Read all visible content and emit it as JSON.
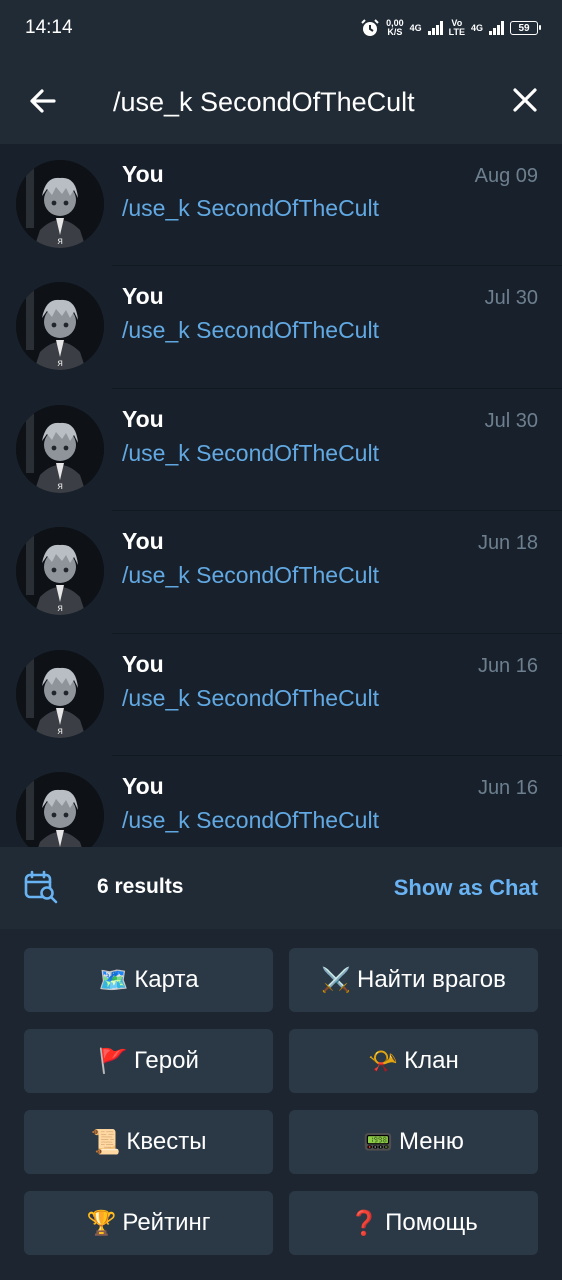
{
  "status": {
    "time": "14:14",
    "netspeed_value": "0,00",
    "netspeed_unit": "K/S",
    "net1": "4G",
    "volte_top": "Vo",
    "volte_bottom": "LTE",
    "net2": "4G",
    "battery": "59"
  },
  "search": {
    "query": "/use_k SecondOfTheCult"
  },
  "results": [
    {
      "title": "You",
      "text": "/use_k SecondOfTheCult",
      "date": "Aug 09",
      "avatar_letter": "я"
    },
    {
      "title": "You",
      "text": "/use_k SecondOfTheCult",
      "date": "Jul 30",
      "avatar_letter": "я"
    },
    {
      "title": "You",
      "text": "/use_k SecondOfTheCult",
      "date": "Jul 30",
      "avatar_letter": "я"
    },
    {
      "title": "You",
      "text": "/use_k SecondOfTheCult",
      "date": "Jun 18",
      "avatar_letter": "я"
    },
    {
      "title": "You",
      "text": "/use_k SecondOfTheCult",
      "date": "Jun 16",
      "avatar_letter": "я"
    },
    {
      "title": "You",
      "text": "/use_k SecondOfTheCult",
      "date": "Jun 16",
      "avatar_letter": "я"
    }
  ],
  "results_bar": {
    "count_label": "6 results",
    "show_as_chat": "Show as Chat"
  },
  "keyboard": [
    {
      "emoji": "🗺️",
      "label": "Карта"
    },
    {
      "emoji": "⚔️",
      "label": "Найти врагов"
    },
    {
      "emoji": "🚩",
      "label": "Герой"
    },
    {
      "emoji": "📯",
      "label": "Клан"
    },
    {
      "emoji": "📜",
      "label": "Квесты"
    },
    {
      "emoji": "📟",
      "label": "Меню"
    },
    {
      "emoji": "🏆",
      "label": "Рейтинг"
    },
    {
      "emoji": "❓",
      "label": "Помощь"
    }
  ],
  "colors": {
    "background": "#18212b",
    "header": "#202b36",
    "link": "#62a9e3",
    "accent": "#6ab3f3",
    "muted": "#6d7f8f",
    "button": "#2b3947"
  }
}
